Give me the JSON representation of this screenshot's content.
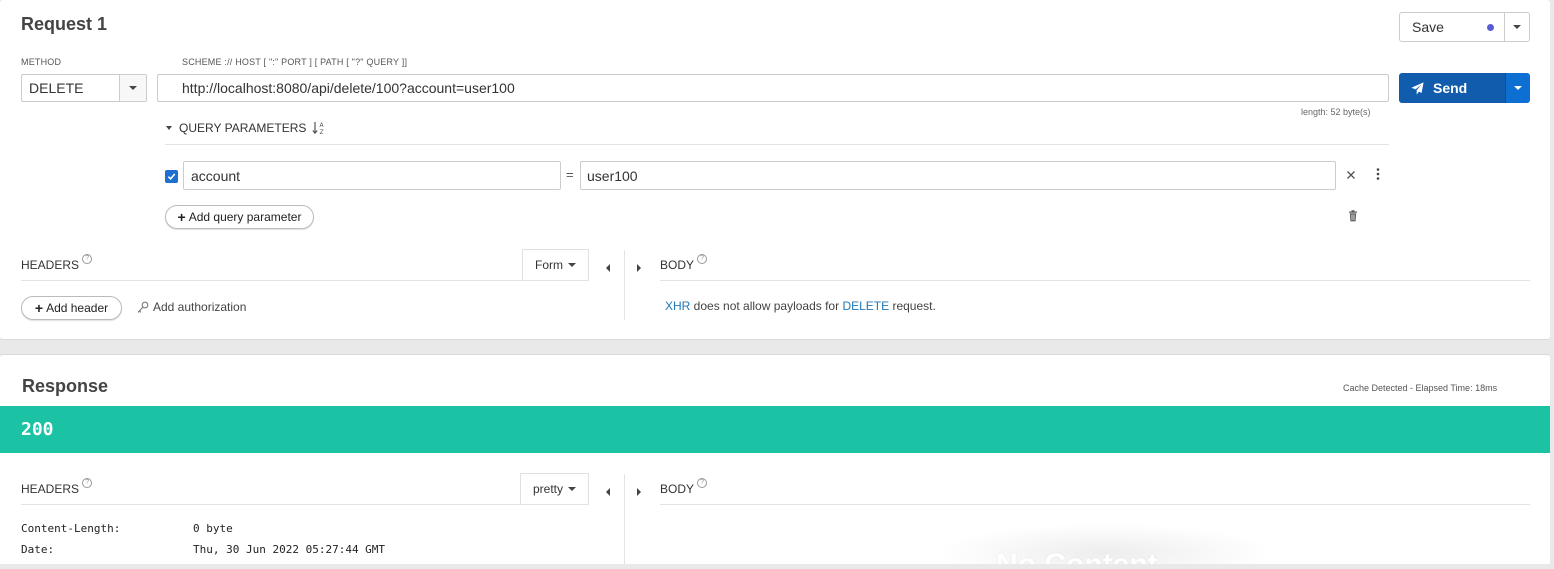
{
  "request": {
    "title": "Request 1",
    "save_label": "Save",
    "save_dot_color": "#5b5bd6",
    "method_label": "METHOD",
    "method_value": "DELETE",
    "url_label": "SCHEME :// HOST [ \":\" PORT ] [ PATH [ \"?\" QUERY ]]",
    "url_value": "http://localhost:8080/api/delete/100?account=user100",
    "send_label": "Send",
    "length_text": "length: 52 byte(s)",
    "query_params_label": "QUERY PARAMETERS",
    "params": [
      {
        "checked": true,
        "key": "account",
        "value": "user100"
      }
    ],
    "equals": "=",
    "add_query_param_label": "Add query parameter",
    "headers_label": "HEADERS",
    "headers_mode": "Form",
    "add_header_label": "Add header",
    "add_authorization_label": "Add authorization",
    "body_label": "BODY",
    "body_msg": {
      "xhr": "XHR",
      "part1": " does not allow payloads for ",
      "method": "DELETE",
      "part2": " request."
    }
  },
  "response": {
    "title": "Response",
    "meta": "Cache Detected - Elapsed Time: 18ms",
    "status_code": "200",
    "status_color": "#1bc2a4",
    "headers_label": "HEADERS",
    "headers_mode": "pretty",
    "body_label": "BODY",
    "headers": [
      {
        "name": "Content-Length:",
        "value": "0 byte"
      },
      {
        "name": "Date:",
        "value": "Thu, 30 Jun 2022 05:27:44 GMT"
      }
    ],
    "body_placeholder": "No Content"
  },
  "icons": {
    "send": "paper-plane-icon",
    "close": "close-icon",
    "more": "vertical-dots-icon",
    "trash": "trash-icon",
    "sort": "sort-alpha-icon",
    "key": "key-icon",
    "help": "help-circle-icon"
  }
}
